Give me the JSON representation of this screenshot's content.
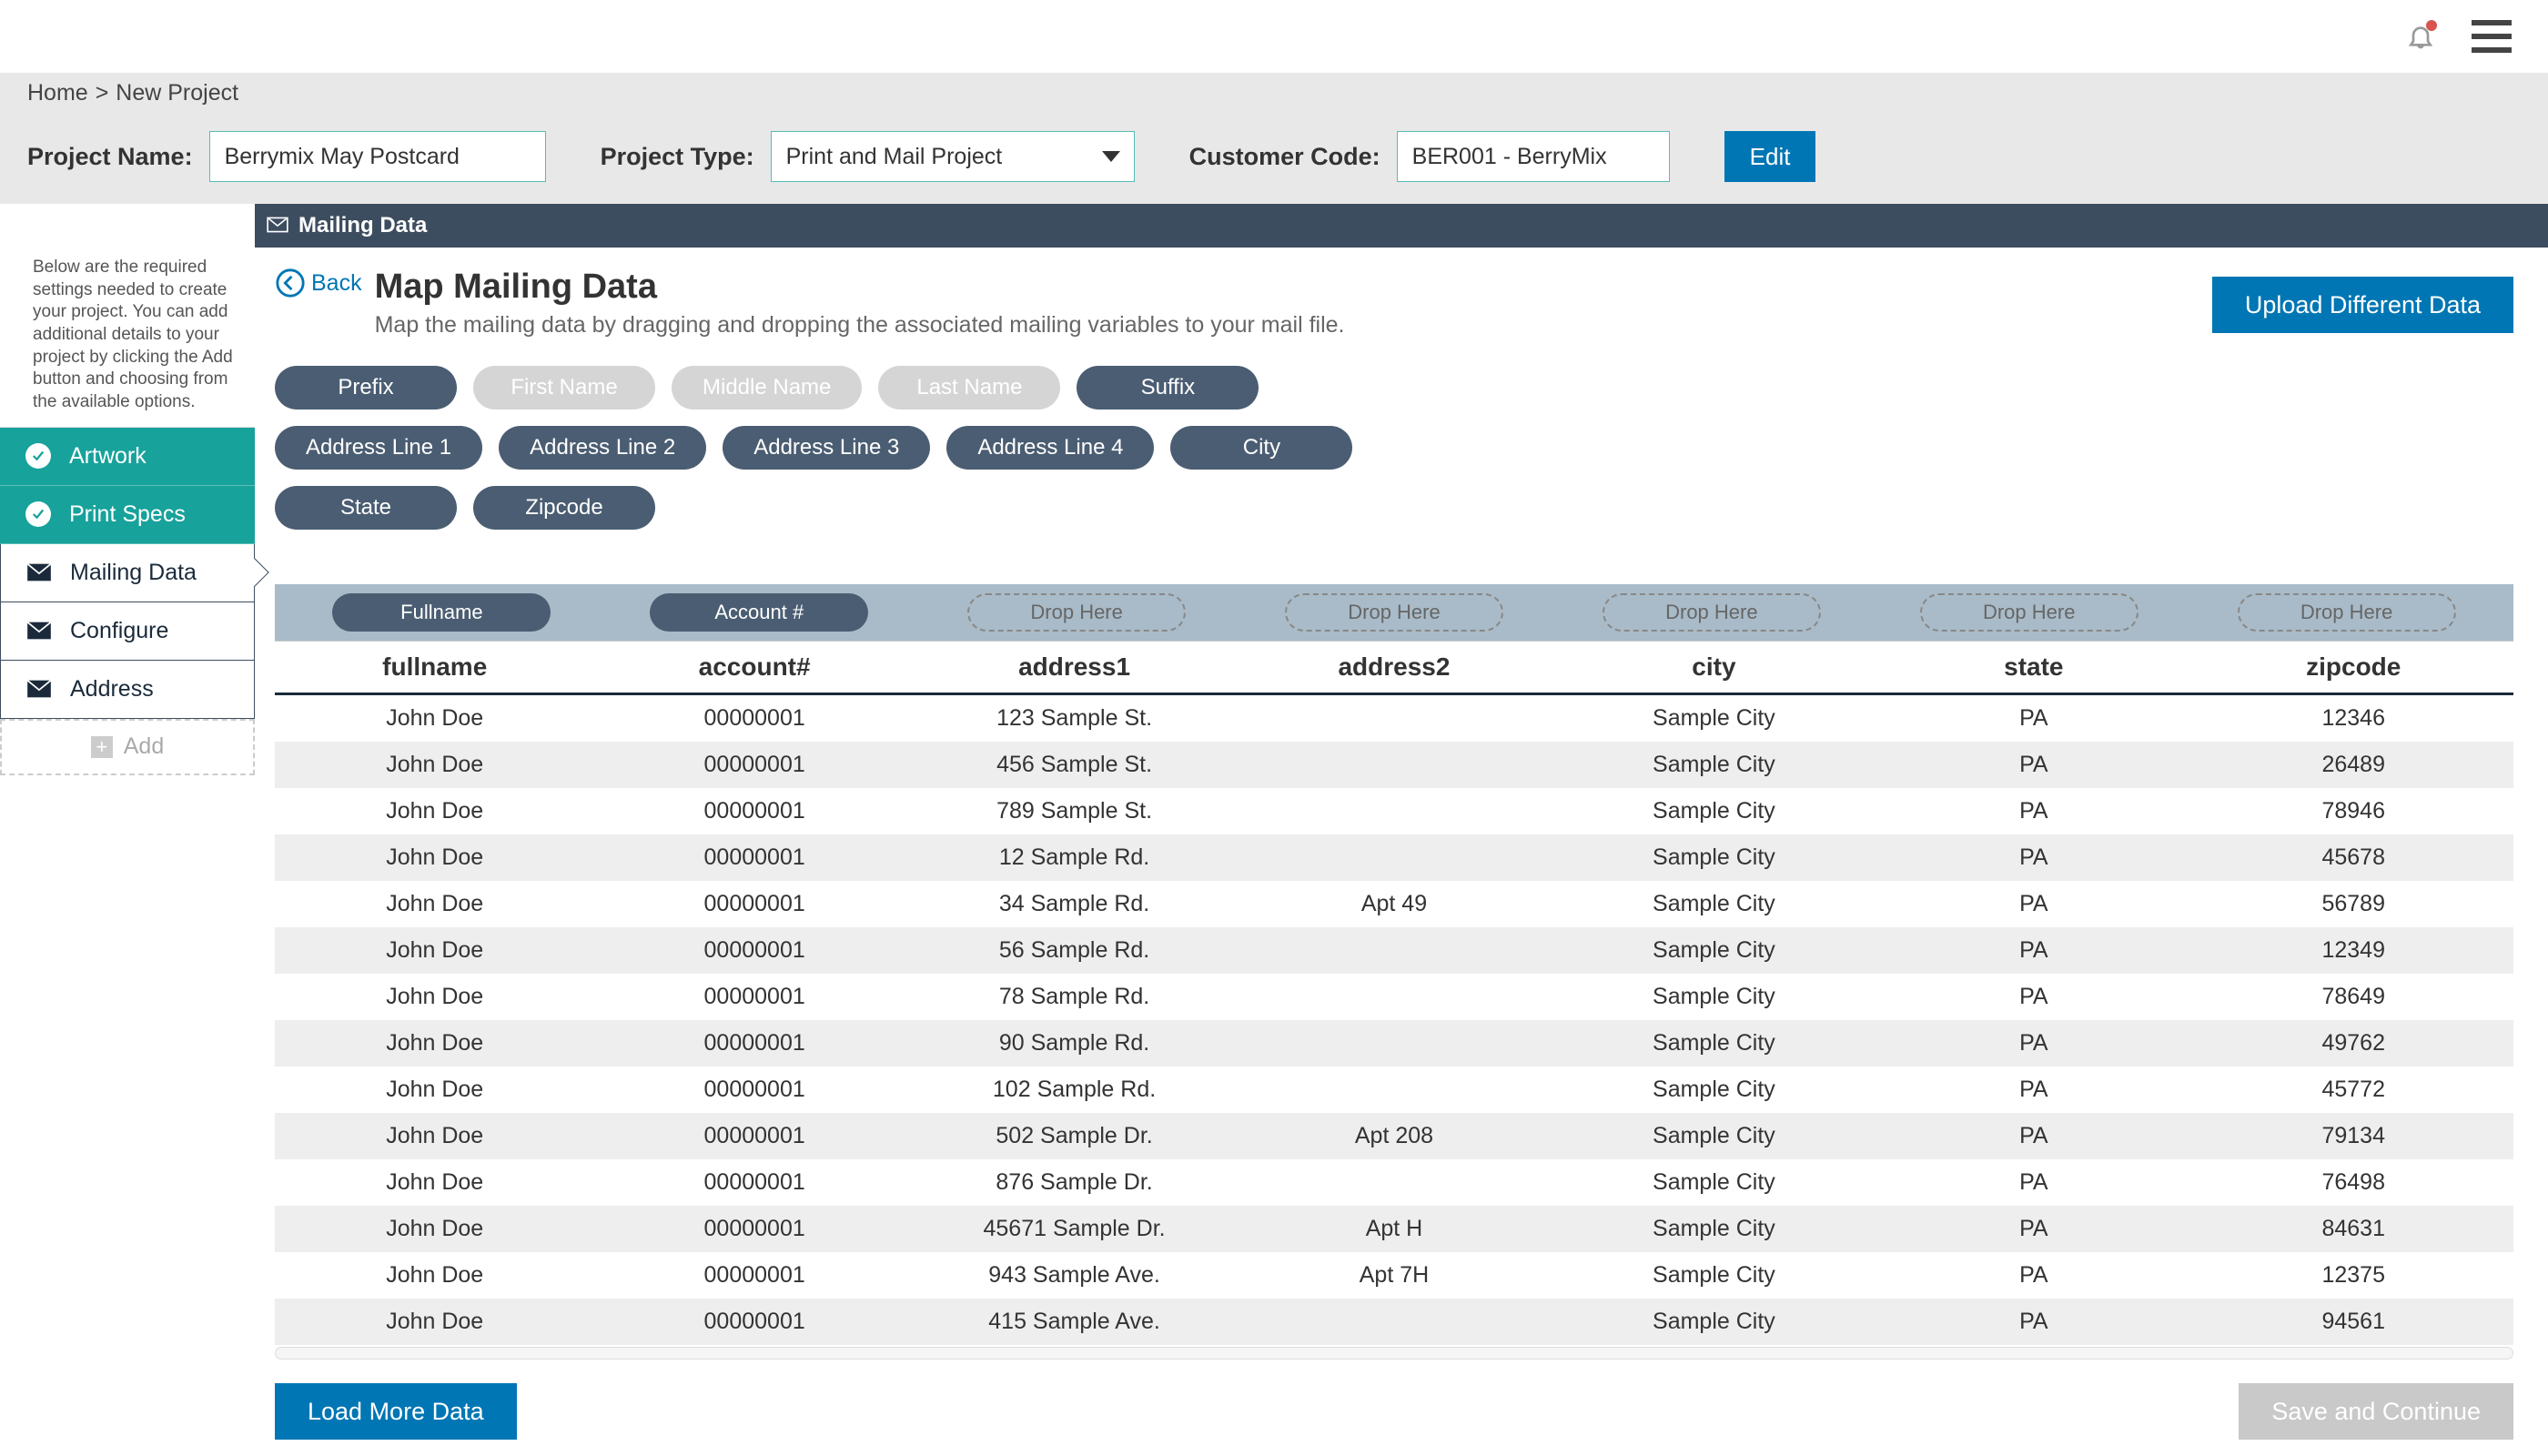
{
  "breadcrumb": {
    "home": "Home",
    "current": "New Project"
  },
  "settings": {
    "project_name_label": "Project Name:",
    "project_name_value": "Berrymix May Postcard",
    "project_type_label": "Project Type:",
    "project_type_value": "Print and Mail Project",
    "customer_code_label": "Customer Code:",
    "customer_code_value": "BER001 - BerryMix",
    "edit_label": "Edit"
  },
  "section_header": {
    "title": "Mailing Data"
  },
  "sidebar": {
    "description": "Below are the required settings needed to create your project. You can add additional details to your project by clicking the Add button and choosing from the available options.",
    "items": [
      {
        "label": "Artwork",
        "status": "done"
      },
      {
        "label": "Print Specs",
        "status": "done"
      },
      {
        "label": "Mailing Data",
        "status": "active"
      },
      {
        "label": "Configure",
        "status": "standard"
      },
      {
        "label": "Address",
        "status": "standard"
      }
    ],
    "add_label": "Add"
  },
  "page": {
    "back_label": "Back",
    "title": "Map Mailing Data",
    "subtitle": "Map the mailing data by dragging and dropping the associated mailing variables to your mail file.",
    "upload_label": "Upload Different Data"
  },
  "pills": [
    {
      "label": "Prefix",
      "disabled": false
    },
    {
      "label": "First Name",
      "disabled": true
    },
    {
      "label": "Middle Name",
      "disabled": true
    },
    {
      "label": "Last Name",
      "disabled": true
    },
    {
      "label": "Suffix",
      "disabled": false
    },
    {
      "label": "Address Line 1",
      "disabled": false
    },
    {
      "label": "Address Line 2",
      "disabled": false
    },
    {
      "label": "Address Line 3",
      "disabled": false
    },
    {
      "label": "Address Line 4",
      "disabled": false
    },
    {
      "label": "City",
      "disabled": false
    },
    {
      "label": "State",
      "disabled": false
    },
    {
      "label": "Zipcode",
      "disabled": false
    }
  ],
  "mapping": {
    "slots": [
      {
        "type": "pill",
        "label": "Fullname"
      },
      {
        "type": "pill",
        "label": "Account #"
      },
      {
        "type": "drop",
        "label": "Drop Here"
      },
      {
        "type": "drop",
        "label": "Drop Here"
      },
      {
        "type": "drop",
        "label": "Drop Here"
      },
      {
        "type": "drop",
        "label": "Drop Here"
      },
      {
        "type": "drop",
        "label": "Drop Here"
      }
    ]
  },
  "table": {
    "headers": [
      "fullname",
      "account#",
      "address1",
      "address2",
      "city",
      "state",
      "zipcode"
    ],
    "rows": [
      [
        "John Doe",
        "00000001",
        "123 Sample St.",
        "",
        "Sample City",
        "PA",
        "12346"
      ],
      [
        "John Doe",
        "00000001",
        "456 Sample St.",
        "",
        "Sample City",
        "PA",
        "26489"
      ],
      [
        "John Doe",
        "00000001",
        "789 Sample St.",
        "",
        "Sample City",
        "PA",
        "78946"
      ],
      [
        "John Doe",
        "00000001",
        "12 Sample Rd.",
        "",
        "Sample City",
        "PA",
        "45678"
      ],
      [
        "John Doe",
        "00000001",
        "34 Sample Rd.",
        "Apt 49",
        "Sample City",
        "PA",
        "56789"
      ],
      [
        "John Doe",
        "00000001",
        "56 Sample Rd.",
        "",
        "Sample City",
        "PA",
        "12349"
      ],
      [
        "John Doe",
        "00000001",
        "78 Sample Rd.",
        "",
        "Sample City",
        "PA",
        "78649"
      ],
      [
        "John Doe",
        "00000001",
        "90 Sample Rd.",
        "",
        "Sample City",
        "PA",
        "49762"
      ],
      [
        "John Doe",
        "00000001",
        "102 Sample Rd.",
        "",
        "Sample City",
        "PA",
        "45772"
      ],
      [
        "John Doe",
        "00000001",
        "502 Sample Dr.",
        "Apt 208",
        "Sample City",
        "PA",
        "79134"
      ],
      [
        "John Doe",
        "00000001",
        "876 Sample Dr.",
        "",
        "Sample City",
        "PA",
        "76498"
      ],
      [
        "John Doe",
        "00000001",
        "45671 Sample Dr.",
        "Apt H",
        "Sample City",
        "PA",
        "84631"
      ],
      [
        "John Doe",
        "00000001",
        "943 Sample Ave.",
        "Apt 7H",
        "Sample City",
        "PA",
        "12375"
      ],
      [
        "John Doe",
        "00000001",
        "415 Sample Ave.",
        "",
        "Sample City",
        "PA",
        "94561"
      ]
    ]
  },
  "buttons": {
    "load_more": "Load More Data",
    "save_continue": "Save and Continue"
  }
}
